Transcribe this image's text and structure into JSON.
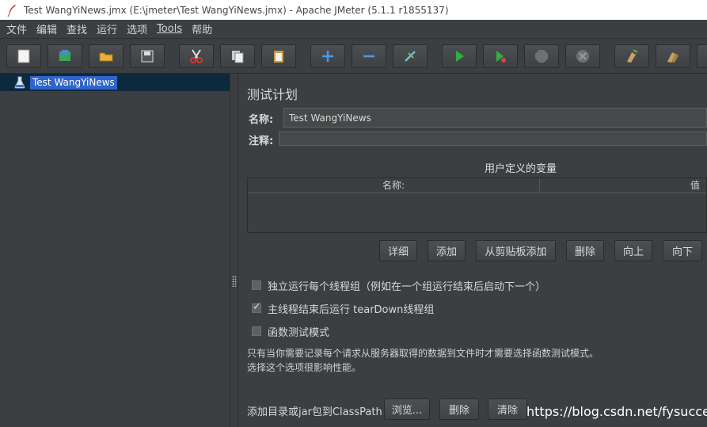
{
  "window": {
    "title": "Test WangYiNews.jmx (E:\\jmeter\\Test WangYiNews.jmx) - Apache JMeter (5.1.1 r1855137)"
  },
  "menu": [
    "文件",
    "编辑",
    "查找",
    "运行",
    "选项",
    "Tools",
    "帮助"
  ],
  "toolbar": {
    "icons": [
      "new-icon",
      "templates-icon",
      "open-icon",
      "save-icon",
      "cut-icon",
      "copy-icon",
      "paste-icon",
      "expand-icon",
      "collapse-icon",
      "toggle-icon",
      "start-icon",
      "start-no-pause-icon",
      "stop-icon",
      "shutdown-icon",
      "clear-icon",
      "clear-all-icon",
      "search-icon"
    ]
  },
  "tree": {
    "root_label": "Test WangYiNews"
  },
  "panel": {
    "title": "测试计划",
    "name_label": "名称:",
    "name_value": "Test WangYiNews",
    "comment_label": "注释:",
    "comment_value": "",
    "variables_title": "用户定义的变量",
    "col_name": "名称:",
    "col_value": "值",
    "buttons": {
      "detail": "详细",
      "add": "添加",
      "add_clipboard": "从剪贴板添加",
      "delete": "删除",
      "up": "向上",
      "down": "向下"
    },
    "options": {
      "serialize": "独立运行每个线程组（例如在一个组运行结束后启动下一个）",
      "teardown": "主线程结束后运行 tearDown线程组",
      "functional": "函数测试模式"
    },
    "note_line1": "只有当你需要记录每个请求从服务器取得的数据到文件时才需要选择函数测试模式。",
    "note_line2": "选择这个选项很影响性能。",
    "classpath_label": "添加目录或jar包到ClassPath",
    "classpath_buttons": {
      "browse": "浏览...",
      "delete": "删除",
      "clear": "清除"
    }
  },
  "watermark": "https://blog.csdn.net/fysuccess"
}
